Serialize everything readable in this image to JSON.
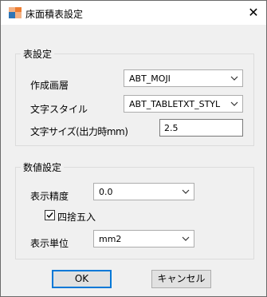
{
  "window": {
    "title": "床面積表設定",
    "close_glyph": "✕"
  },
  "table_settings": {
    "group_label": "表設定",
    "layer_label": "作成画層",
    "layer_value": "ABT_MOJI",
    "style_label": "文字スタイル",
    "style_value": "ABT_TABLETXT_STYL",
    "size_label": "文字サイズ(出力時mm)",
    "size_value": "2.5"
  },
  "numeric_settings": {
    "group_label": "数値設定",
    "precision_label": "表示精度",
    "precision_value": "0.0",
    "round_label": "四捨五入",
    "round_checked": true,
    "unit_label": "表示単位",
    "unit_value": "mm2"
  },
  "buttons": {
    "ok": "OK",
    "cancel": "キャンセル"
  },
  "colors": {
    "accent": "#0078d7"
  }
}
